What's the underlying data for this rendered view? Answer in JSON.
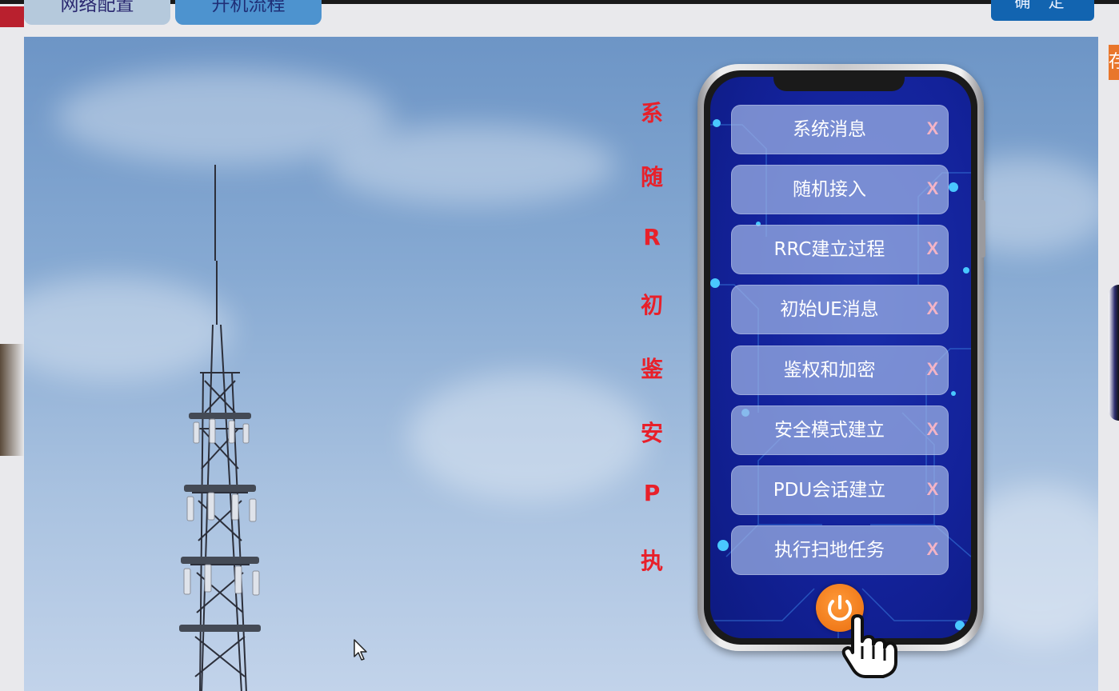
{
  "tabs": [
    {
      "label": "网络配置"
    },
    {
      "label": "开机流程"
    }
  ],
  "confirm_button": {
    "label": "确 定"
  },
  "right_edge_glyph": "存",
  "side_labels": [
    "系",
    "随",
    "R",
    "初",
    "鉴",
    "安",
    "P",
    "执"
  ],
  "menu_items": [
    {
      "label": "系统消息",
      "close": "X"
    },
    {
      "label": "随机接入",
      "close": "X"
    },
    {
      "label": "RRC建立过程",
      "close": "X"
    },
    {
      "label": "初始UE消息",
      "close": "X"
    },
    {
      "label": "鉴权和加密",
      "close": "X"
    },
    {
      "label": "安全模式建立",
      "close": "X"
    },
    {
      "label": "PDU会话建立",
      "close": "X"
    },
    {
      "label": "执行扫地任务",
      "close": "X"
    }
  ],
  "icons": {
    "power": "power-icon",
    "pointer_hand": "hand-pointer-icon",
    "mouse_cursor": "arrow-cursor-icon"
  },
  "colors": {
    "side_label": "#e8202a",
    "power_button": "#f07a1a",
    "phone_screen": "#13229a",
    "confirm_button": "#1264b0"
  }
}
